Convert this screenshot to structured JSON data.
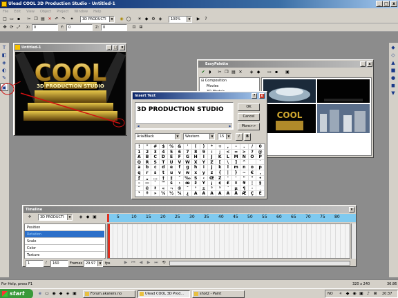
{
  "app": {
    "title": "Ulead COOL 3D Production Studio - Untitled-1"
  },
  "menu": [
    "File",
    "Edit",
    "View",
    "Object",
    "Project",
    "Window",
    "Help"
  ],
  "toolbar1": {
    "object_select": "3D PRODUCTI",
    "zoom": "100%"
  },
  "toolbar2": {
    "x_label": "X:",
    "x_value": "0",
    "y_label": "Y:",
    "y_value": "0",
    "z_label": "Z:",
    "z_value": "0"
  },
  "doc_window": {
    "title": "Untitled-1"
  },
  "insert_text": {
    "title": "Insert Text",
    "text_value": "3D PRODUCTION STUDIO",
    "ok": "OK",
    "cancel": "Cancel",
    "more": "More>>",
    "font": "ArialBlack",
    "script": "Western",
    "size": "15",
    "italic": "I",
    "bold": "B",
    "chars": "!\"#$%&'()*+,-./0123456789:;<=>?@ABCDEFGHIJKLMNOPQRSTUVWXYZ[\\]^_`abcdefghijklmnopqrstuvwxyz{|}~€‚ƒ„…†‡ˆ‰Š‹ŒŽ''\"\"•–—˜™š›œžŸ¡¢£¤¥¦§¨©ª«¬®¯°±²³´µ¶·¸¹º»¼½¾¿ÀÁÂÃÄÅÆÇÈÉÊËÌÍÎÏÐÑÒÓÔÕÖ×ØÙÚÛÜÝÞßàáâãäåæçèéêëìíîïðñòóôõö÷øùúûüýþÿ"
  },
  "easypalette": {
    "title": "EasyPalette",
    "tree": [
      "Composition",
      "Movies",
      "3D Models"
    ]
  },
  "timeline": {
    "title": "Timeline",
    "object": "3D PRODUCTI",
    "rows": [
      "Position",
      "Rotation",
      "Scale",
      "Color",
      "Texture"
    ],
    "selected_row": 1,
    "ticks": [
      "5",
      "10",
      "15",
      "20",
      "25",
      "30",
      "35",
      "40",
      "45",
      "50",
      "55",
      "60",
      "65",
      "70",
      "75",
      "80"
    ],
    "frame_current": "1",
    "frame_total": "160",
    "frames_label": "Frames",
    "fps_value": "29.97",
    "fps_label": "fps"
  },
  "status": {
    "help": "For Help, press F1",
    "dims": "320 x 240",
    "mem": "36.86"
  },
  "taskbar": {
    "start": "start",
    "items": [
      "Forum.akaners.no",
      "Ulead COOL 3D Prod...",
      "shot2 - Paint"
    ],
    "tray_lang": "NO",
    "clock": "20:37"
  },
  "colors": {
    "title_active": "#0a246a",
    "workspace": "#8c8c8c",
    "timeline_ruler": "#7fcaf0",
    "selected_row": "#2c6fc9"
  }
}
